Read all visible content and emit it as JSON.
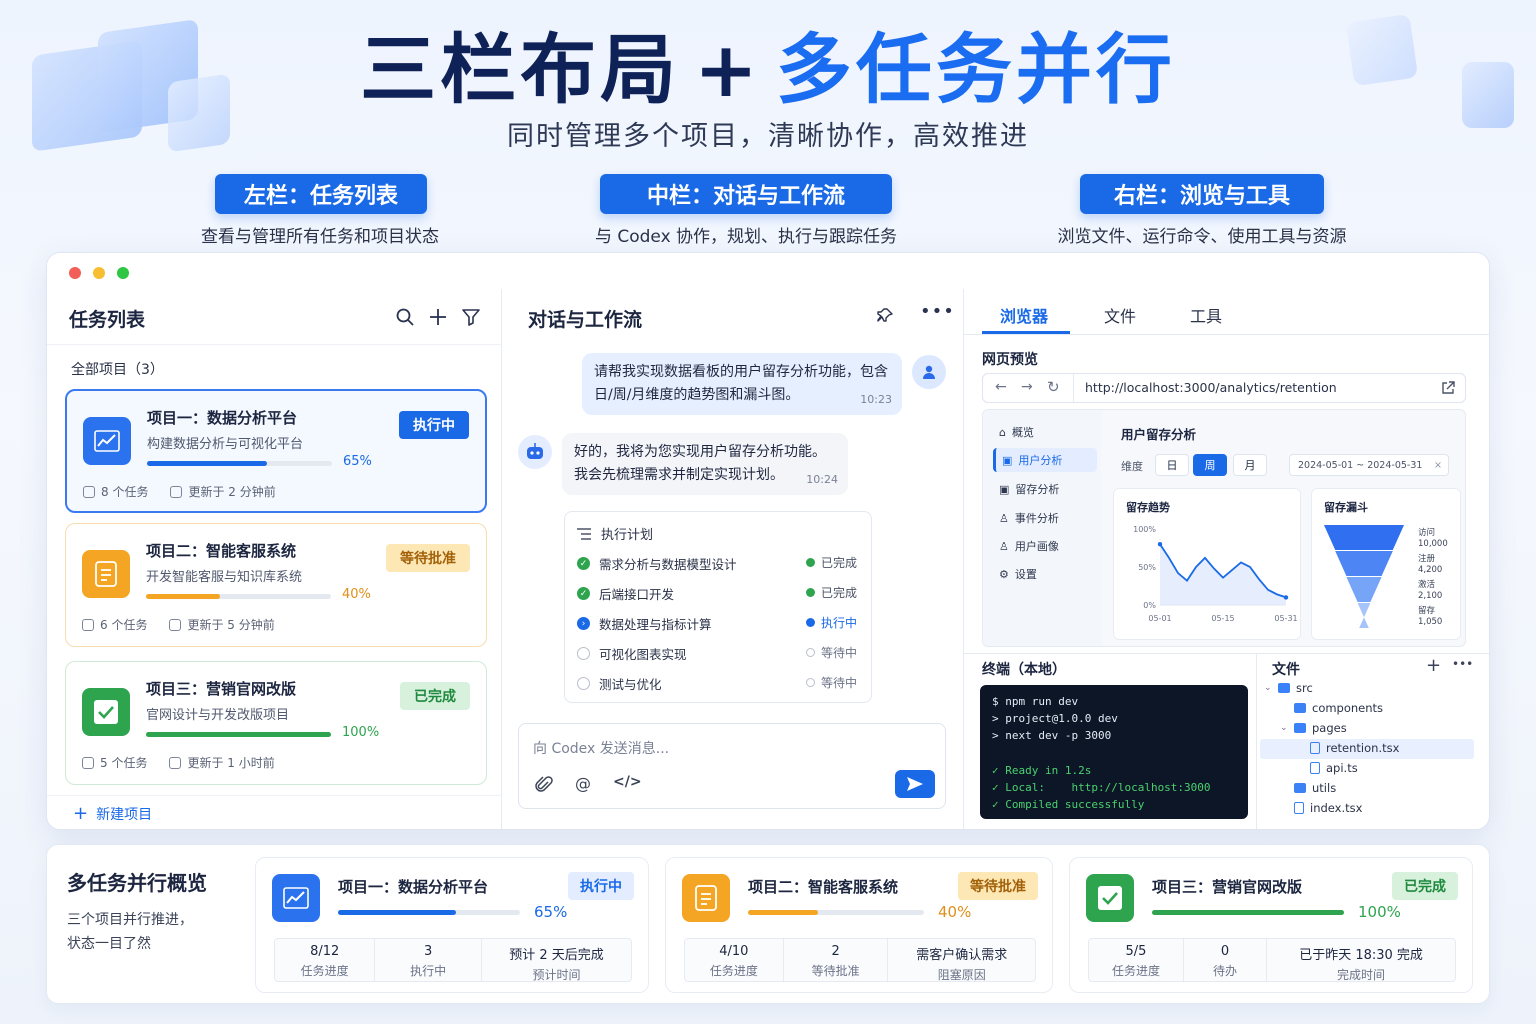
{
  "header": {
    "title_a": "三栏布局",
    "title_plus": "+",
    "title_b": "多任务并行",
    "subtitle": "同时管理多个项目，清晰协作，高效推进"
  },
  "sections": [
    {
      "label": "左栏：任务列表",
      "desc": "查看与管理所有任务和项目状态"
    },
    {
      "label": "中栏：对话与工作流",
      "desc": "与 Codex 协作，规划、执行与跟踪任务"
    },
    {
      "label": "右栏：浏览与工具",
      "desc": "浏览文件、运行命令、使用工具与资源"
    }
  ],
  "left": {
    "title": "任务列表",
    "filter_label": "全部项目（3）",
    "projects": [
      {
        "name": "项目一：数据分析平台",
        "desc": "构建数据分析与可视化平台",
        "status": "执行中",
        "progress": 65,
        "pct": "65%",
        "tasks": "8 个任务",
        "updated": "更新于 2 分钟前"
      },
      {
        "name": "项目二：智能客服系统",
        "desc": "开发智能客服与知识库系统",
        "status": "等待批准",
        "progress": 40,
        "pct": "40%",
        "tasks": "6 个任务",
        "updated": "更新于 5 分钟前"
      },
      {
        "name": "项目三：营销官网改版",
        "desc": "官网设计与开发改版项目",
        "status": "已完成",
        "progress": 100,
        "pct": "100%",
        "tasks": "5 个任务",
        "updated": "更新于 1 小时前"
      }
    ],
    "new_project": "新建项目"
  },
  "middle": {
    "title": "对话与工作流",
    "user_msg": "请帮我实现数据看板的用户留存分析功能，包含日/周/月维度的趋势图和漏斗图。",
    "user_time": "10:23",
    "bot_msg": "好的，我将为您实现用户留存分析功能。我会先梳理需求并制定实现计划。",
    "bot_time": "10:24",
    "plan_title": "执行计划",
    "steps": [
      {
        "name": "需求分析与数据模型设计",
        "status": "已完成",
        "state": "done"
      },
      {
        "name": "后端接口开发",
        "status": "已完成",
        "state": "done"
      },
      {
        "name": "数据处理与指标计算",
        "status": "执行中",
        "state": "running"
      },
      {
        "name": "可视化图表实现",
        "status": "等待中",
        "state": "pending"
      },
      {
        "name": "测试与优化",
        "status": "等待中",
        "state": "pending"
      }
    ],
    "input_placeholder": "向 Codex 发送消息..."
  },
  "right": {
    "tabs": [
      "浏览器",
      "文件",
      "工具"
    ],
    "preview_label": "网页预览",
    "url": "http://localhost:3000/analytics/retention",
    "nav": [
      "概览",
      "用户分析",
      "留存分析",
      "事件分析",
      "用户画像",
      "设置"
    ],
    "page_title": "用户留存分析",
    "dim_label": "维度",
    "dims": [
      "日",
      "周",
      "月"
    ],
    "date_range": "2024-05-01 ~ 2024-05-31",
    "trend_title": "留存趋势",
    "funnel_title": "留存漏斗",
    "terminal_title": "终端（本地）",
    "terminal_lines": [
      {
        "t": "$ npm run dev",
        "ok": false
      },
      {
        "t": "> project@1.0.0 dev",
        "ok": false
      },
      {
        "t": "> next dev -p 3000",
        "ok": false
      },
      {
        "t": "",
        "ok": false
      },
      {
        "t": "✓ Ready in 1.2s",
        "ok": true
      },
      {
        "t": "✓ Local:    http://localhost:3000",
        "ok": true
      },
      {
        "t": "✓ Compiled successfully",
        "ok": true
      }
    ],
    "files_title": "文件",
    "files": [
      {
        "name": "src",
        "type": "folder",
        "indent": 0,
        "arrow": true
      },
      {
        "name": "components",
        "type": "folder",
        "indent": 1,
        "arrow": false
      },
      {
        "name": "pages",
        "type": "folder",
        "indent": 1,
        "arrow": true
      },
      {
        "name": "retention.tsx",
        "type": "file",
        "indent": 2,
        "arrow": false,
        "selected": true
      },
      {
        "name": "api.ts",
        "type": "file",
        "indent": 2,
        "arrow": false
      },
      {
        "name": "utils",
        "type": "folder",
        "indent": 1,
        "arrow": false
      },
      {
        "name": "index.tsx",
        "type": "file",
        "indent": 1,
        "arrow": false
      }
    ]
  },
  "chart_data": {
    "type": "line",
    "title": "留存趋势",
    "x_ticks": [
      "05-01",
      "05-15",
      "05-31"
    ],
    "y_ticks": [
      "100%",
      "50%",
      "0%"
    ],
    "ylim": [
      0,
      100
    ],
    "values": [
      80,
      62,
      42,
      32,
      50,
      62,
      48,
      36,
      46,
      56,
      50,
      34,
      20,
      14,
      10
    ],
    "funnel": [
      {
        "label": "访问",
        "value": "10,000"
      },
      {
        "label": "注册",
        "value": "4,200"
      },
      {
        "label": "激活",
        "value": "2,100"
      },
      {
        "label": "留存",
        "value": "1,050"
      }
    ]
  },
  "overview": {
    "title": "多任务并行概览",
    "desc1": "三个项目并行推进，",
    "desc2": "状态一目了然",
    "cards": [
      {
        "name": "项目一：数据分析平台",
        "status": "执行中",
        "pct": "65%",
        "progress": 65,
        "stats": [
          {
            "v": "8/12",
            "l": "任务进度"
          },
          {
            "v": "3",
            "l": "执行中"
          },
          {
            "v": "预计 2 天后完成",
            "l": "预计时间"
          }
        ]
      },
      {
        "name": "项目二：智能客服系统",
        "status": "等待批准",
        "pct": "40%",
        "progress": 40,
        "stats": [
          {
            "v": "4/10",
            "l": "任务进度"
          },
          {
            "v": "2",
            "l": "等待批准"
          },
          {
            "v": "需客户确认需求",
            "l": "阻塞原因"
          }
        ]
      },
      {
        "name": "项目三：营销官网改版",
        "status": "已完成",
        "pct": "100%",
        "progress": 100,
        "stats": [
          {
            "v": "5/5",
            "l": "任务进度"
          },
          {
            "v": "0",
            "l": "待办"
          },
          {
            "v": "已于昨天 18:30 完成",
            "l": "完成时间"
          }
        ]
      }
    ]
  },
  "colors": {
    "blue": "#1a6ae8",
    "orange": "#f5a524",
    "green": "#2ea44f"
  }
}
